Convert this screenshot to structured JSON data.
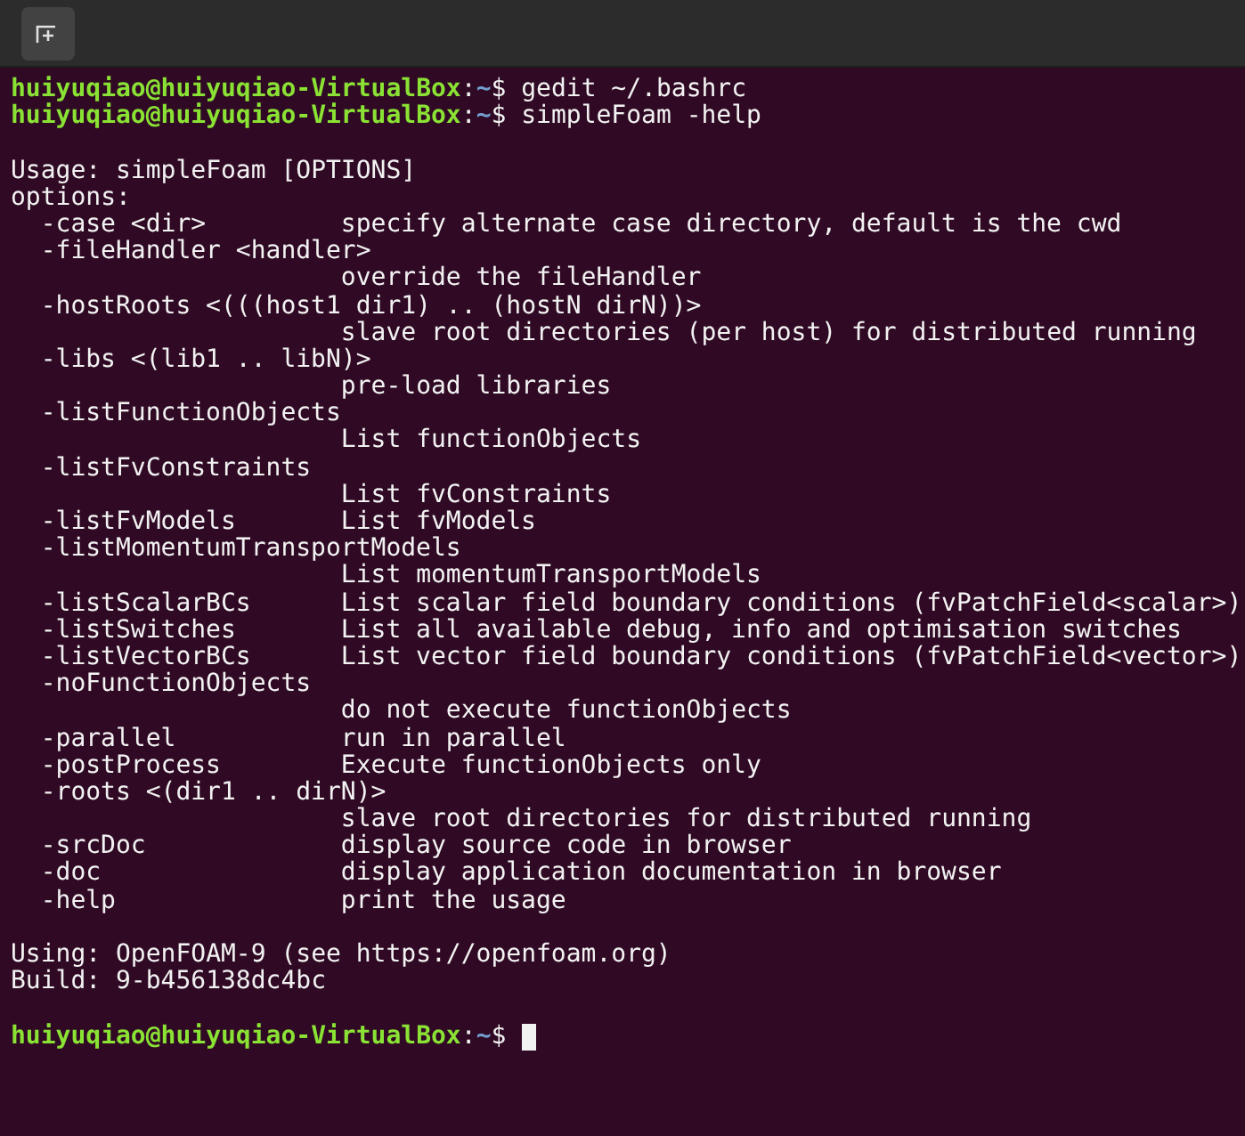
{
  "header": {
    "new_tab_button": true
  },
  "terminal": {
    "lines": [
      {
        "kind": "prompt",
        "user_host": "huiyuqiao@huiyuqiao-VirtualBox",
        "separator": ":",
        "path": "~",
        "symbol": "$",
        "command": "gedit ~/.bashrc"
      },
      {
        "kind": "prompt",
        "user_host": "huiyuqiao@huiyuqiao-VirtualBox",
        "separator": ":",
        "path": "~",
        "symbol": "$",
        "command": "simpleFoam -help"
      },
      {
        "kind": "blank"
      },
      {
        "kind": "output",
        "text": "Usage: simpleFoam [OPTIONS]"
      },
      {
        "kind": "output",
        "text": "options:"
      },
      {
        "kind": "option_inline",
        "flag": "-case <dir>",
        "description": "specify alternate case directory, default is the cwd"
      },
      {
        "kind": "option_wrapped",
        "flag": "-fileHandler <handler>",
        "description": "override the fileHandler"
      },
      {
        "kind": "option_wrapped",
        "flag": "-hostRoots <(((host1 dir1) .. (hostN dirN))>",
        "description": "slave root directories (per host) for distributed running"
      },
      {
        "kind": "option_wrapped",
        "flag": "-libs <(lib1 .. libN)>",
        "description": "pre-load libraries"
      },
      {
        "kind": "option_wrapped",
        "flag": "-listFunctionObjects",
        "description": "List functionObjects"
      },
      {
        "kind": "option_wrapped",
        "flag": "-listFvConstraints",
        "description": "List fvConstraints"
      },
      {
        "kind": "option_inline",
        "flag": "-listFvModels",
        "description": "List fvModels"
      },
      {
        "kind": "option_wrapped",
        "flag": "-listMomentumTransportModels",
        "description": "List momentumTransportModels"
      },
      {
        "kind": "option_inline",
        "flag": "-listScalarBCs",
        "description": "List scalar field boundary conditions (fvPatchField<scalar>)"
      },
      {
        "kind": "option_inline",
        "flag": "-listSwitches",
        "description": "List all available debug, info and optimisation switches"
      },
      {
        "kind": "option_inline",
        "flag": "-listVectorBCs",
        "description": "List vector field boundary conditions (fvPatchField<vector>)"
      },
      {
        "kind": "option_wrapped",
        "flag": "-noFunctionObjects",
        "description": "do not execute functionObjects"
      },
      {
        "kind": "option_inline",
        "flag": "-parallel",
        "description": "run in parallel"
      },
      {
        "kind": "option_inline",
        "flag": "-postProcess",
        "description": "Execute functionObjects only"
      },
      {
        "kind": "option_wrapped",
        "flag": "-roots <(dir1 .. dirN)>",
        "description": "slave root directories for distributed running"
      },
      {
        "kind": "option_inline",
        "flag": "-srcDoc",
        "description": "display source code in browser"
      },
      {
        "kind": "option_inline",
        "flag": "-doc",
        "description": "display application documentation in browser"
      },
      {
        "kind": "option_inline",
        "flag": "-help",
        "description": "print the usage"
      },
      {
        "kind": "blank"
      },
      {
        "kind": "output",
        "text": "Using: OpenFOAM-9 (see https://openfoam.org)"
      },
      {
        "kind": "output",
        "text": "Build: 9-b456138dc4bc"
      },
      {
        "kind": "blank"
      },
      {
        "kind": "prompt",
        "user_host": "huiyuqiao@huiyuqiao-VirtualBox",
        "separator": ":",
        "path": "~",
        "symbol": "$",
        "cursor": true
      }
    ]
  }
}
